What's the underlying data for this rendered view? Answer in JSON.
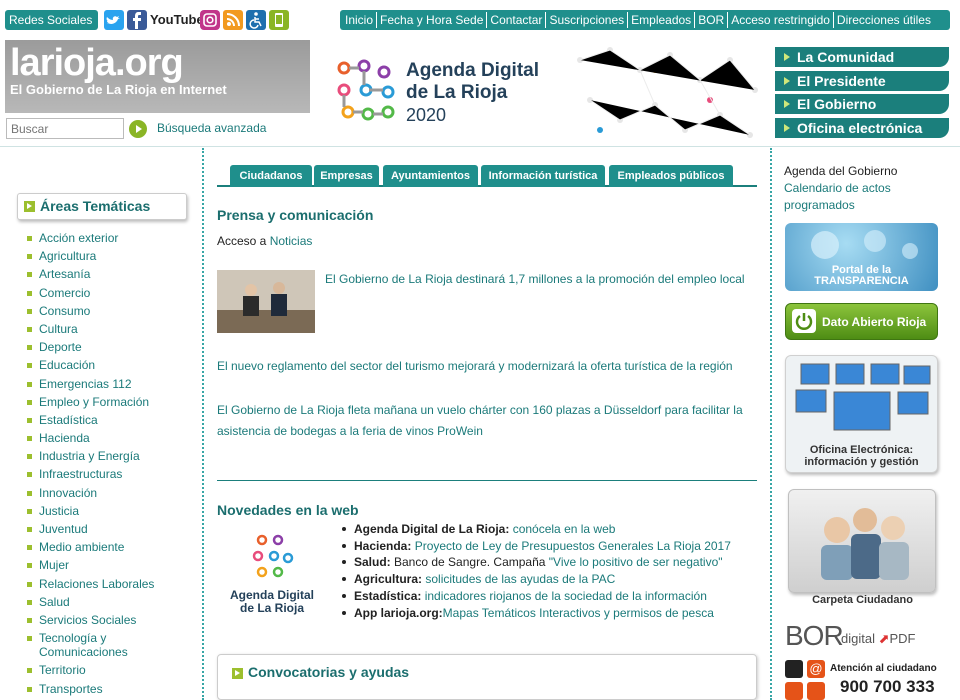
{
  "topbar": {
    "social_label": "Redes Sociales",
    "social_icons": [
      "twitter-icon",
      "facebook-icon",
      "youtube-icon",
      "instagram-icon",
      "rss-icon",
      "accessibility-icon",
      "mobile-app-icon"
    ],
    "youtube_text": "YouTube",
    "nav": [
      "Inicio",
      "Fecha y Hora Sede",
      "Contactar",
      "Suscripciones",
      "Empleados",
      "BOR",
      "Acceso restringido",
      "Direcciones útiles"
    ]
  },
  "header": {
    "logo_title": "larioja.org",
    "logo_subtitle": "El Gobierno de La Rioja en Internet",
    "search_placeholder": "Buscar",
    "advanced_search": "Búsqueda avanzada",
    "agenda_line1": "Agenda Digital",
    "agenda_line2": "de La Rioja",
    "agenda_year": "2020"
  },
  "right_menu": [
    "La Comunidad",
    "El Presidente",
    "El Gobierno",
    "Oficina electrónica"
  ],
  "areas": {
    "title": "Áreas Temáticas",
    "items": [
      "Acción exterior",
      "Agricultura",
      "Artesanía",
      "Comercio",
      "Consumo",
      "Cultura",
      "Deporte",
      "Educación",
      "Emergencias 112",
      "Empleo y Formación",
      "Estadística",
      "Hacienda",
      "Industria y Energía",
      "Infraestructuras",
      "Innovación",
      "Justicia",
      "Juventud",
      "Medio ambiente",
      "Mujer",
      "Relaciones Laborales",
      "Salud",
      "Servicios Sociales",
      "Tecnología y Comunicaciones",
      "Territorio",
      "Transportes"
    ]
  },
  "tabs": [
    "Ciudadanos",
    "Empresas",
    "Ayuntamientos",
    "Información turística",
    "Empleados públicos"
  ],
  "prensa": {
    "title": "Prensa y comunicación",
    "access_prefix": "Acceso a ",
    "access_link": "Noticias",
    "news": [
      "El Gobierno de La Rioja destinará 1,7 millones a la promoción del empleo local",
      "El nuevo reglamento del sector del turismo mejorará y modernizará la oferta turística de la región",
      "El Gobierno de La Rioja fleta mañana un vuelo chárter con 160 plazas a Düsseldorf para facilitar la asistencia de bodegas a la feria de vinos ProWein"
    ]
  },
  "novedades": {
    "title": "Novedades en la web",
    "logo_line1": "Agenda Digital",
    "logo_line2": "de La Rioja",
    "items": [
      {
        "label": "Agenda Digital de La Rioja:",
        "plain": "",
        "link": " conócela en la web"
      },
      {
        "label": "Hacienda:",
        "plain": "",
        "link": " Proyecto de Ley de Presupuestos Generales La Rioja 2017"
      },
      {
        "label": "Salud:",
        "plain": " Banco de Sangre. Campaña ",
        "link": "\"Vive lo positivo de ser negativo\""
      },
      {
        "label": "Agricultura:",
        "plain": "",
        "link": " solicitudes de las ayudas de la PAC"
      },
      {
        "label": "Estadística:",
        "plain": "",
        "link": " indicadores riojanos de la sociedad de la información"
      },
      {
        "label": "App larioja.org:",
        "plain": "",
        "link": "Mapas Temáticos Interactivos y permisos de pesca"
      }
    ]
  },
  "convocatorias": {
    "title": "Convocatorias y ayudas"
  },
  "right_col": {
    "agenda_title": "Agenda del Gobierno",
    "agenda_link": "Calendario de actos programados",
    "transparencia_line1": "Portal de la",
    "transparencia_line2": "TRANSPARENCIA",
    "dato_abierto": "Dato Abierto Rioja",
    "oficina_line1": "Oficina Electrónica:",
    "oficina_line2": "información y gestión",
    "carpeta": "Carpeta Ciudadano",
    "bor": "BOR",
    "bor_digital": "digital",
    "bor_pdf": "PDF",
    "atencion": "Atención al ciudadano",
    "phone": "900 700 333"
  },
  "colors": {
    "teal": "#1f8f8c",
    "green": "#9cbf2e",
    "dark_teal": "#1b6e6e"
  }
}
